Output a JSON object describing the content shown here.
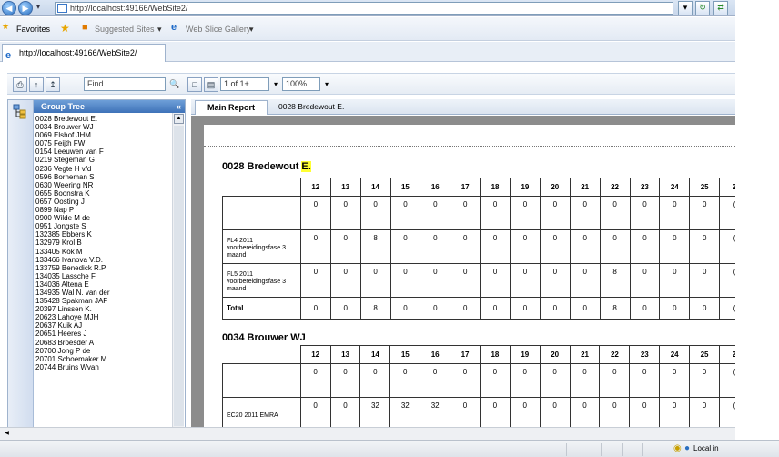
{
  "browser": {
    "url": "http://localhost:49166/WebSite2/",
    "favorites_label": "Favorites",
    "suggested_sites": "Suggested Sites",
    "web_slice_gallery": "Web Slice Gallery",
    "tab_title": "http://localhost:49166/WebSite2/",
    "status_zone": "Local in"
  },
  "viewer_toolbar": {
    "find_placeholder": "Find...",
    "page_value": "1 of 1+",
    "zoom_value": "100%"
  },
  "group_tree": {
    "title": "Group Tree",
    "collapse": "«",
    "items": [
      "0028 Bredewout E.",
      "0034 Brouwer WJ",
      "0069 Elshof JHM",
      "0075 Feijth FW",
      "0154 Leeuwen van F",
      "0219 Stegeman G",
      "0236 Vegte H v/d",
      "0596 Borneman S",
      "0630 Weering NR",
      "0655 Boonstra K",
      "0657 Oosting J",
      "0899 Nap P",
      "0900 Wilde M de",
      "0951 Jongste S",
      "132385 Ebbers K",
      "132979 Krol B",
      "133405 Kok M",
      "133466 Ivanova V.D.",
      "133759 Benedick R.P.",
      "134035 Lassche F",
      "134036 Altena E",
      "134935 Wal N. van der",
      "135428 Spakman JAF",
      "20397 Linssen K.",
      "20623 Lahoye MJH",
      "20637 Kuik AJ",
      "20651 Heeres J",
      "20683 Broesder A",
      "20700 Jong P de",
      "20701 Schoemaker M",
      "20744 Bruins Wvan"
    ]
  },
  "report_tabs": {
    "main": "Main Report",
    "sub": "0028 Bredewout E."
  },
  "report": {
    "columns": [
      "12",
      "13",
      "14",
      "15",
      "16",
      "17",
      "18",
      "19",
      "20",
      "21",
      "22",
      "23",
      "24",
      "25",
      "2"
    ],
    "sections": [
      {
        "title_plain": "0028 Bredewout ",
        "title_highlight": "E.",
        "rows": [
          {
            "label": "",
            "values": [
              "0",
              "0",
              "0",
              "0",
              "0",
              "0",
              "0",
              "0",
              "0",
              "0",
              "0",
              "0",
              "0",
              "0",
              "("
            ]
          },
          {
            "label": "FL4 2011 voorbereidingsfase 3 maand",
            "values": [
              "0",
              "0",
              "8",
              "0",
              "0",
              "0",
              "0",
              "0",
              "0",
              "0",
              "0",
              "0",
              "0",
              "0",
              "("
            ]
          },
          {
            "label": "FL5 2011 voorbereidingsfase 3 maand",
            "values": [
              "0",
              "0",
              "0",
              "0",
              "0",
              "0",
              "0",
              "0",
              "0",
              "0",
              "8",
              "0",
              "0",
              "0",
              "("
            ]
          },
          {
            "label": "Total",
            "values": [
              "0",
              "0",
              "8",
              "0",
              "0",
              "0",
              "0",
              "0",
              "0",
              "0",
              "8",
              "0",
              "0",
              "0",
              "("
            ],
            "total": true
          }
        ]
      },
      {
        "title_plain": "0034 Brouwer WJ",
        "title_highlight": "",
        "rows": [
          {
            "label": "",
            "values": [
              "0",
              "0",
              "0",
              "0",
              "0",
              "0",
              "0",
              "0",
              "0",
              "0",
              "0",
              "0",
              "0",
              "0",
              "("
            ]
          },
          {
            "label": "EC20 2011 EMRA",
            "values": [
              "0",
              "0",
              "32",
              "32",
              "32",
              "0",
              "0",
              "0",
              "0",
              "0",
              "0",
              "0",
              "0",
              "0",
              "("
            ]
          }
        ]
      }
    ]
  }
}
